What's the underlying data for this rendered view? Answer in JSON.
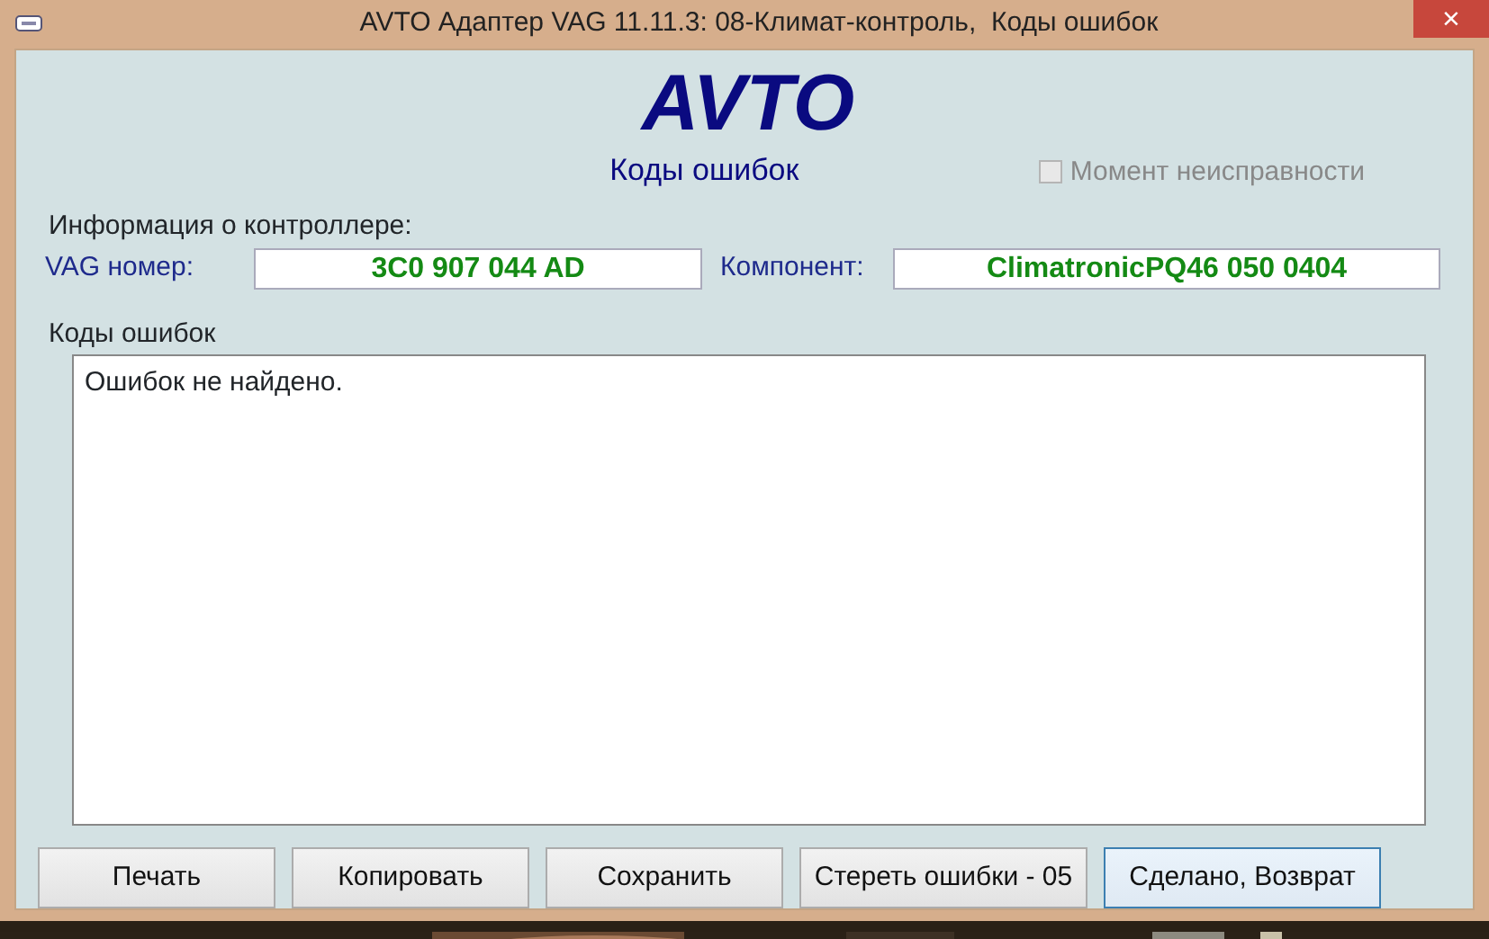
{
  "window": {
    "title": "AVTO Адаптер VAG 11.11.3: 08-Климат-контроль,  Коды ошибок",
    "close": "×"
  },
  "header": {
    "logo": "AVTO",
    "subtitle": "Коды ошибок"
  },
  "fault_moment": {
    "label": "Момент неисправности",
    "checked": false,
    "disabled": true
  },
  "controller_info": {
    "title": "Информация о контроллере:",
    "vag_label": "VAG номер:",
    "vag_value": "3C0 907 044 AD",
    "component_label": "Компонент:",
    "component_value": "ClimatronicPQ46 050 0404"
  },
  "fault_codes": {
    "label": "Коды ошибок",
    "text": "Ошибок не найдено."
  },
  "buttons": [
    {
      "label": "Печать",
      "default": false
    },
    {
      "label": "Копировать",
      "default": false
    },
    {
      "label": "Сохранить",
      "default": false
    },
    {
      "label": "Стереть ошибки - 05",
      "default": false
    },
    {
      "label": "Сделано, Возврат",
      "default": true
    }
  ]
}
